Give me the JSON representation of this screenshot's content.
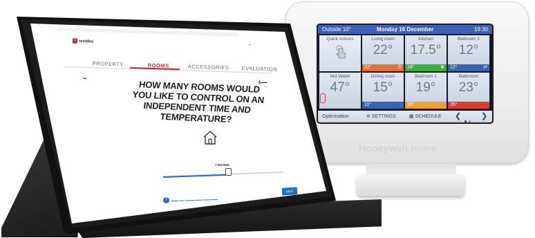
{
  "thermostat": {
    "outside": "Outside 10°",
    "date": "Monday 16 December",
    "time": "19:30",
    "tiles": [
      {
        "name": "Quick Actions",
        "temp": "",
        "bar": "",
        "bar_color": ""
      },
      {
        "name": "Living room",
        "temp": "22°",
        "bar": "22°",
        "bar_color": "#e8742a",
        "icon": "timer-icon"
      },
      {
        "name": "Kitchen",
        "temp": "17.5°",
        "bar": "18°",
        "bar_color": "#3fae3c",
        "icon": "leaf-icon"
      },
      {
        "name": "Bedroom 2",
        "temp": "12°",
        "bar": "12°",
        "bar_color": "#3a63b3",
        "icon": "link-icon"
      },
      {
        "name": "Hot Water",
        "temp": "47°",
        "bar": "",
        "bar_color": ""
      },
      {
        "name": "Dining room",
        "temp": "15°",
        "bar": "11°",
        "bar_color": "#3a63b3"
      },
      {
        "name": "Bedroom 1",
        "temp": "19°",
        "bar": "19°",
        "bar_color": "#f0a12a"
      },
      {
        "name": "Bathroom",
        "temp": "23°",
        "bar": "25°",
        "bar_color": "#e23a2e"
      }
    ],
    "bottom": {
      "optimisation": "Optimisation",
      "settings": "SETTINGS",
      "schedule": "SCHEDULE",
      "prev": "❮",
      "next": "❯"
    },
    "brand": "Honeywell",
    "brand_suffix": " Home"
  },
  "tablet": {
    "logo": "resideo",
    "tabs": [
      "PROPERTY",
      "ROOMS",
      "ACCESSORIES",
      "EVALUATION"
    ],
    "active_tab": 1,
    "question": "HOW MANY ROOMS WOULD YOU LIKE TO CONTROL ON AN INDEPENDENT TIME AND TEMPERATURE?",
    "slider_label": "7 ROOMS",
    "next_label": "NEXT"
  }
}
